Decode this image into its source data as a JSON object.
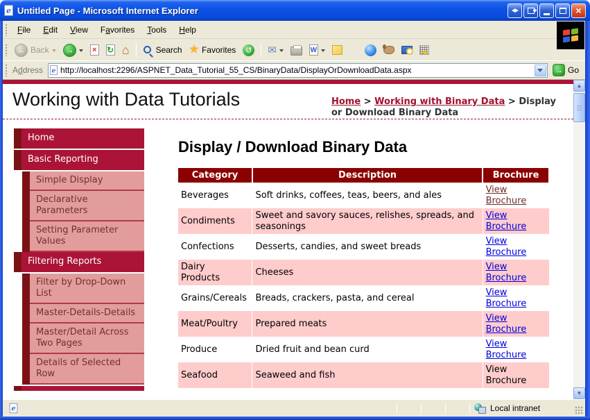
{
  "window": {
    "title": "Untitled Page - Microsoft Internet Explorer",
    "controls": [
      "horizontal-arrows",
      "popout",
      "minimize",
      "maximize",
      "close"
    ]
  },
  "menu": {
    "items": [
      {
        "label": "File",
        "accel": "F"
      },
      {
        "label": "Edit",
        "accel": "E"
      },
      {
        "label": "View",
        "accel": "V"
      },
      {
        "label": "Favorites",
        "accel": "a"
      },
      {
        "label": "Tools",
        "accel": "T"
      },
      {
        "label": "Help",
        "accel": "H"
      }
    ]
  },
  "toolbar": {
    "back_label": "Back",
    "search_label": "Search",
    "favorites_label": "Favorites",
    "icons": [
      "back",
      "forward",
      "stop",
      "refresh",
      "home",
      "search",
      "favorites",
      "history",
      "mail",
      "print",
      "edit-word",
      "discuss",
      "messenger",
      "research",
      "encarta",
      "tools-grid"
    ]
  },
  "address": {
    "label": "Address",
    "accel": "d",
    "url": "http://localhost:2296/ASPNET_Data_Tutorial_55_CS/BinaryData/DisplayOrDownloadData.aspx",
    "go_label": "Go"
  },
  "page": {
    "site_title": "Working with Data Tutorials",
    "breadcrumb": {
      "links": [
        "Home",
        "Working with Binary Data"
      ],
      "separator": ">",
      "current": "Display or Download Binary Data"
    },
    "sidebar": [
      {
        "label": "Home",
        "level": 1
      },
      {
        "label": "Basic Reporting",
        "level": 1
      },
      {
        "label": "Simple Display",
        "level": 2
      },
      {
        "label": "Declarative Parameters",
        "level": 2
      },
      {
        "label": "Setting Parameter Values",
        "level": 2
      },
      {
        "label": "Filtering Reports",
        "level": 1
      },
      {
        "label": "Filter by Drop-Down List",
        "level": 2
      },
      {
        "label": "Master-Details-Details",
        "level": 2
      },
      {
        "label": "Master/Detail Across Two Pages",
        "level": 2
      },
      {
        "label": "Details of Selected Row",
        "level": 2
      }
    ],
    "heading": "Display / Download Binary Data",
    "table": {
      "columns": [
        "Category",
        "Description",
        "Brochure"
      ],
      "rows": [
        {
          "category": "Beverages",
          "description": "Soft drinks, coffees, teas, beers, and ales",
          "brochure": "View Brochure",
          "brochure_style": "visited"
        },
        {
          "category": "Condiments",
          "description": "Sweet and savory sauces, relishes, spreads, and seasonings",
          "brochure": "View Brochure",
          "brochure_style": "link"
        },
        {
          "category": "Confections",
          "description": "Desserts, candies, and sweet breads",
          "brochure": "View Brochure",
          "brochure_style": "link"
        },
        {
          "category": "Dairy Products",
          "description": "Cheeses",
          "brochure": "View Brochure",
          "brochure_style": "link"
        },
        {
          "category": "Grains/Cereals",
          "description": "Breads, crackers, pasta, and cereal",
          "brochure": "View Brochure",
          "brochure_style": "link"
        },
        {
          "category": "Meat/Poultry",
          "description": "Prepared meats",
          "brochure": "View Brochure",
          "brochure_style": "link"
        },
        {
          "category": "Produce",
          "description": "Dried fruit and bean curd",
          "brochure": "View Brochure",
          "brochure_style": "link"
        },
        {
          "category": "Seafood",
          "description": "Seaweed and fish",
          "brochure": "View Brochure",
          "brochure_style": "none"
        }
      ]
    }
  },
  "statusbar": {
    "zone": "Local intranet"
  },
  "colors": {
    "crimson": "#AB1437",
    "maroon": "#7A1215",
    "pink": "#E39C9C",
    "pink_text": "#6E312E",
    "pink_sep": "#B23B47",
    "table_header": "#8B0101",
    "alt_row": "#FFCCCC",
    "link_blue": "#0000DD",
    "link_visited": "#6F2D2D",
    "breadcrumb_link": "#A01130"
  }
}
